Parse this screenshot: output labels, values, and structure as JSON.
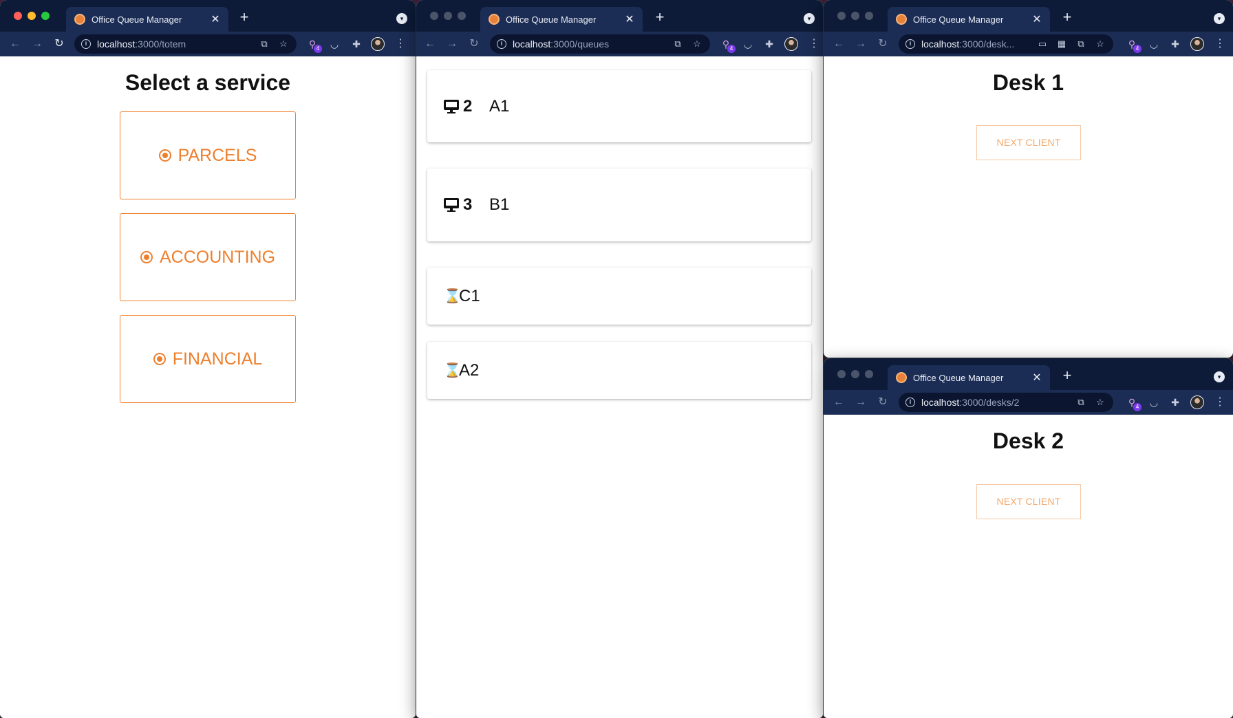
{
  "windows": {
    "totem": {
      "tab_title": "Office Queue Manager",
      "url_host": "localhost",
      "url_path": ":3000/totem",
      "title": "Select a service",
      "services": [
        {
          "label": "PARCELS"
        },
        {
          "label": "ACCOUNTING"
        },
        {
          "label": "FINANCIAL"
        }
      ]
    },
    "queues": {
      "tab_title": "Office Queue Manager",
      "url_host": "localhost",
      "url_path": ":3000/queues",
      "entries": [
        {
          "desk": "2",
          "ticket": "A1",
          "status": "serving"
        },
        {
          "desk": "3",
          "ticket": "B1",
          "status": "serving"
        },
        {
          "ticket": "C1",
          "status": "waiting"
        },
        {
          "ticket": "A2",
          "status": "waiting"
        }
      ]
    },
    "desk1": {
      "tab_title": "Office Queue Manager",
      "url_host": "localhost",
      "url_path": ":3000/desk...",
      "title": "Desk 1",
      "button": "NEXT CLIENT"
    },
    "desk2": {
      "tab_title": "Office Queue Manager",
      "url_host": "localhost",
      "url_path": ":3000/desks/2",
      "title": "Desk 2",
      "button": "NEXT CLIENT"
    }
  },
  "browser": {
    "tab_close": "✕",
    "new_tab": "+",
    "tab_menu": "▾",
    "back": "←",
    "forward": "→",
    "reload": "↻",
    "info": "i",
    "extension_badge": "4",
    "kebab": "⋮"
  },
  "icons": {
    "monitor": "monitor-icon",
    "hourglass": "⌛"
  },
  "colors": {
    "accent": "#ee7f2d",
    "accent_light": "#f2a86c",
    "tab_bar": "#0d1b38",
    "toolbar": "#1c2d55"
  }
}
